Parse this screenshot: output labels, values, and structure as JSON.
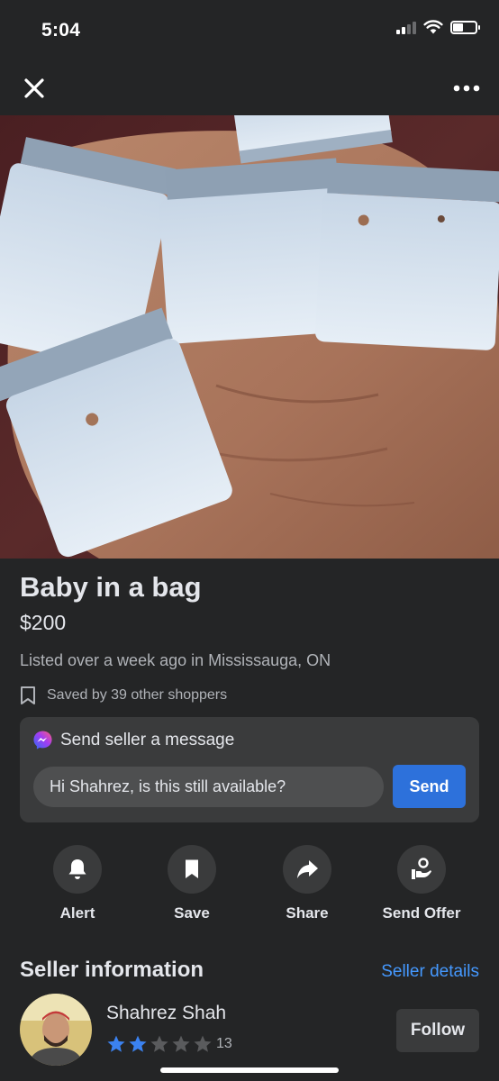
{
  "status_bar": {
    "time": "5:04",
    "icons": [
      "cellular-signal-icon",
      "wifi-icon",
      "battery-icon"
    ],
    "signal_bars_active": 2,
    "signal_bars_total": 4,
    "battery_level": 0.35
  },
  "nav": {
    "close_icon": "close-icon",
    "more_icon": "more-dots-icon"
  },
  "listing": {
    "title": "Baby in a bag",
    "price": "$200",
    "listed": "Listed over a week ago in Mississauga, ON",
    "saved": "Saved by 39 other shoppers"
  },
  "message": {
    "heading": "Send seller a message",
    "input_value": "Hi Shahrez, is this still available?",
    "send_label": "Send"
  },
  "actions": [
    {
      "label": "Alert",
      "icon": "bell-icon"
    },
    {
      "label": "Save",
      "icon": "bookmark-icon"
    },
    {
      "label": "Share",
      "icon": "share-arrow-icon"
    },
    {
      "label": "Send Offer",
      "icon": "hand-offer-icon"
    }
  ],
  "seller": {
    "heading": "Seller information",
    "details_link": "Seller details",
    "name": "Shahrez Shah",
    "stars_filled": 2,
    "stars_total": 5,
    "rating_count": "13",
    "follow_label": "Follow"
  },
  "colors": {
    "background": "#242526",
    "card": "#3a3b3c",
    "accent_blue": "#2d71db",
    "link_blue": "#4599ff",
    "star_blue": "#3b82f0",
    "muted_text": "#b0b3b8"
  }
}
